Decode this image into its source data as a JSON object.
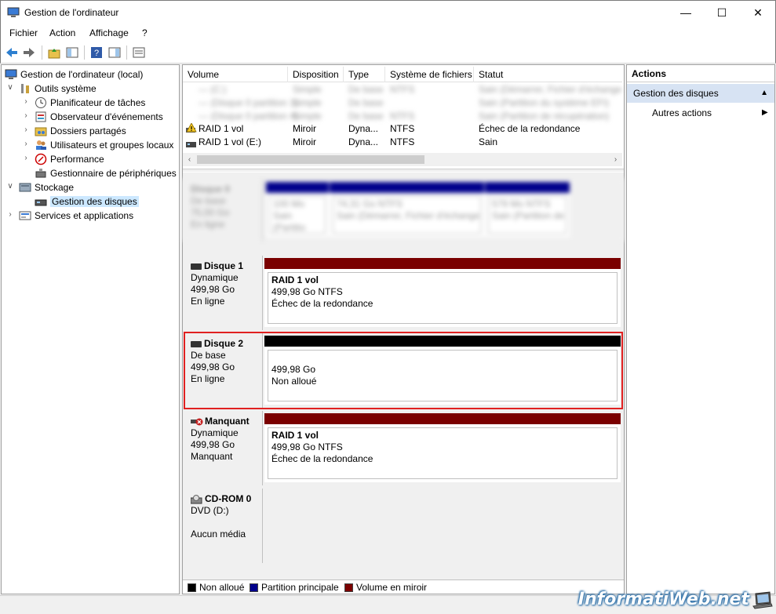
{
  "window": {
    "title": "Gestion de l'ordinateur",
    "min": "—",
    "max": "☐",
    "close": "✕"
  },
  "menu": [
    "Fichier",
    "Action",
    "Affichage",
    "?"
  ],
  "tree": {
    "root": "Gestion de l'ordinateur (local)",
    "outils": "Outils système",
    "items_outils": [
      "Planificateur de tâches",
      "Observateur d'événements",
      "Dossiers partagés",
      "Utilisateurs et groupes locaux",
      "Performance",
      "Gestionnaire de périphériques"
    ],
    "stockage": "Stockage",
    "gestion": "Gestion des disques",
    "services": "Services et applications"
  },
  "volumes": {
    "columns": [
      "Volume",
      "Disposition",
      "Type",
      "Système de fichiers",
      "Statut"
    ],
    "blurred_rows": [
      [
        "— (C:)",
        "Simple",
        "De base",
        "NTFS",
        "Sain (Démarrer, Fichier d'échange"
      ],
      [
        "— (Disque 0 partition 1)",
        "Simple",
        "De base",
        "",
        "Sain (Partition du système EFI)"
      ],
      [
        "— (Disque 0 partition 4)",
        "Simple",
        "De base",
        "NTFS",
        "Sain (Partition de récupération)"
      ]
    ],
    "rows": [
      [
        "RAID 1 vol",
        "Miroir",
        "Dyna...",
        "NTFS",
        "Échec de la redondance"
      ],
      [
        "RAID 1 vol (E:)",
        "Miroir",
        "Dyna...",
        "NTFS",
        "Sain"
      ]
    ]
  },
  "disk0": {
    "name": "Disque 0",
    "lines": [
      "De base",
      "75,00 Go",
      "En ligne"
    ],
    "parts": [
      {
        "size": "100 Mo",
        "fs": "Sain (Partitio"
      },
      {
        "size": "74,31 Go NTFS",
        "fs": "Sain (Démarrer, Fichier d'échange"
      },
      {
        "size": "579 Mo NTFS",
        "fs": "Sain (Partition de"
      }
    ]
  },
  "disks": [
    {
      "name": "Disque 1",
      "lines": [
        "Dynamique",
        "499,98 Go",
        "En ligne"
      ],
      "part_name": "RAID 1 vol",
      "part_lines": [
        "499,98 Go NTFS",
        "Échec de la redondance"
      ],
      "bar_color": "#7a0000"
    },
    {
      "name": "Disque 2",
      "lines": [
        "De base",
        "499,98 Go",
        "En ligne"
      ],
      "part_name": "",
      "part_lines": [
        "499,98 Go",
        "Non alloué"
      ],
      "bar_color": "#000000"
    },
    {
      "name": "Manquant",
      "lines": [
        "Dynamique",
        "499,98 Go",
        "Manquant"
      ],
      "part_name": "RAID 1 vol",
      "part_lines": [
        "499,98 Go NTFS",
        "Échec de la redondance"
      ],
      "bar_color": "#7a0000"
    }
  ],
  "cdrom": {
    "name": "CD-ROM 0",
    "lines": [
      "DVD (D:)",
      "",
      "Aucun média"
    ]
  },
  "legend": [
    {
      "label": "Non alloué",
      "color": "#000000"
    },
    {
      "label": "Partition principale",
      "color": "#00008b"
    },
    {
      "label": "Volume en miroir",
      "color": "#7a0000"
    }
  ],
  "actions": {
    "title": "Actions",
    "section": "Gestion des disques",
    "item": "Autres actions"
  },
  "watermark": "InformatiWeb.net"
}
